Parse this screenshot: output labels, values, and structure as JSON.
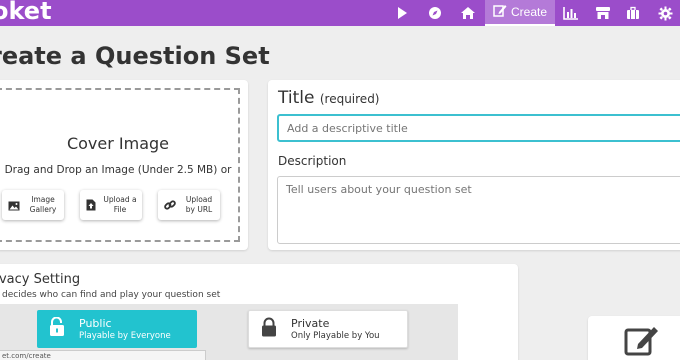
{
  "header": {
    "logo_text": "oket",
    "nav": [
      {
        "icon": "play-icon"
      },
      {
        "icon": "compass-icon"
      },
      {
        "icon": "home-icon"
      },
      {
        "icon": "edit-icon",
        "label": "Create",
        "active": true
      },
      {
        "icon": "chart-icon"
      },
      {
        "icon": "store-icon"
      },
      {
        "icon": "briefcase-icon"
      },
      {
        "icon": "gear-icon"
      }
    ],
    "bar_color": "#9b4dca"
  },
  "page": {
    "title": "reate a Question Set"
  },
  "cover": {
    "title": "Cover Image",
    "subtitle": "Drag and Drop an Image (Under 2.5 MB) or",
    "buttons": [
      {
        "label": "Image Gallery",
        "icon": "image-icon"
      },
      {
        "label": "Upload a File",
        "icon": "file-upload-icon"
      },
      {
        "label": "Upload by URL",
        "icon": "link-icon"
      }
    ]
  },
  "form": {
    "title_label": "Title",
    "title_required": "(required)",
    "title_placeholder": "Add a descriptive title",
    "desc_label": "Description",
    "desc_placeholder": "Tell users about your question set"
  },
  "privacy": {
    "title": "rivacy Setting",
    "subtitle": "is decides who can find and play your question set",
    "options": [
      {
        "title": "Public",
        "subtitle": "Playable by Everyone",
        "icon": "unlock-icon",
        "selected": true,
        "color": "#22c3cf"
      },
      {
        "title": "Private",
        "subtitle": "Only Playable by You",
        "icon": "lock-icon",
        "selected": false
      }
    ]
  },
  "statusbar": {
    "url": "et.com/create"
  }
}
